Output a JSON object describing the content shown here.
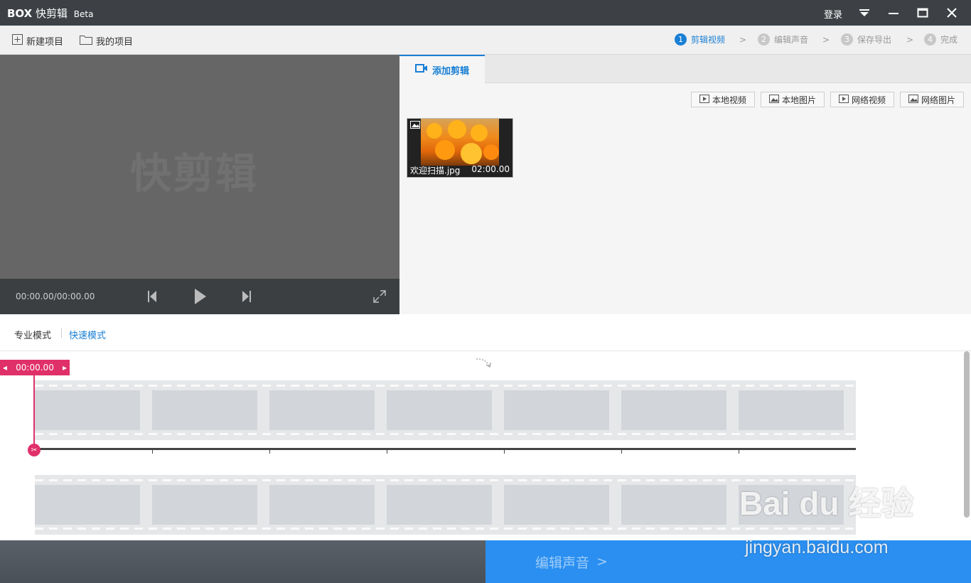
{
  "app": {
    "logo_box": "BOX",
    "logo_name": "快剪辑",
    "logo_beta": "Beta",
    "login": "登录",
    "icons": {
      "menu": "dropdown-menu-icon",
      "minimize": "minimize-icon",
      "maximize": "maximize-icon",
      "close": "close-icon"
    }
  },
  "toolbar": {
    "new_project": "新建项目",
    "my_projects": "我的项目",
    "steps": [
      {
        "num": "1",
        "label": "剪辑视频"
      },
      {
        "num": "2",
        "label": "编辑声音"
      },
      {
        "num": "3",
        "label": "保存导出"
      },
      {
        "num": "4",
        "label": "完成"
      }
    ]
  },
  "preview": {
    "watermark": "快剪辑",
    "time": "00:00.00/00:00.00"
  },
  "clips_panel": {
    "tab_label": "添加剪辑",
    "sources": [
      "本地视频",
      "本地图片",
      "网络视频",
      "网络图片"
    ],
    "clip": {
      "name": "欢迎扫描.jpg",
      "duration": "02:00.00"
    }
  },
  "modes": {
    "pro": "专业模式",
    "fast": "快速模式"
  },
  "timeline": {
    "playhead_time": "00:00.00"
  },
  "footer": {
    "next_label": "编辑声音"
  },
  "watermark": {
    "brand": "Bai du 经验",
    "url": "jingyan.baidu.com"
  },
  "colors": {
    "accent": "#1a7fd4",
    "playhead": "#e0306a",
    "titlebar": "#3d4145",
    "next_button": "#2a8ff0"
  }
}
